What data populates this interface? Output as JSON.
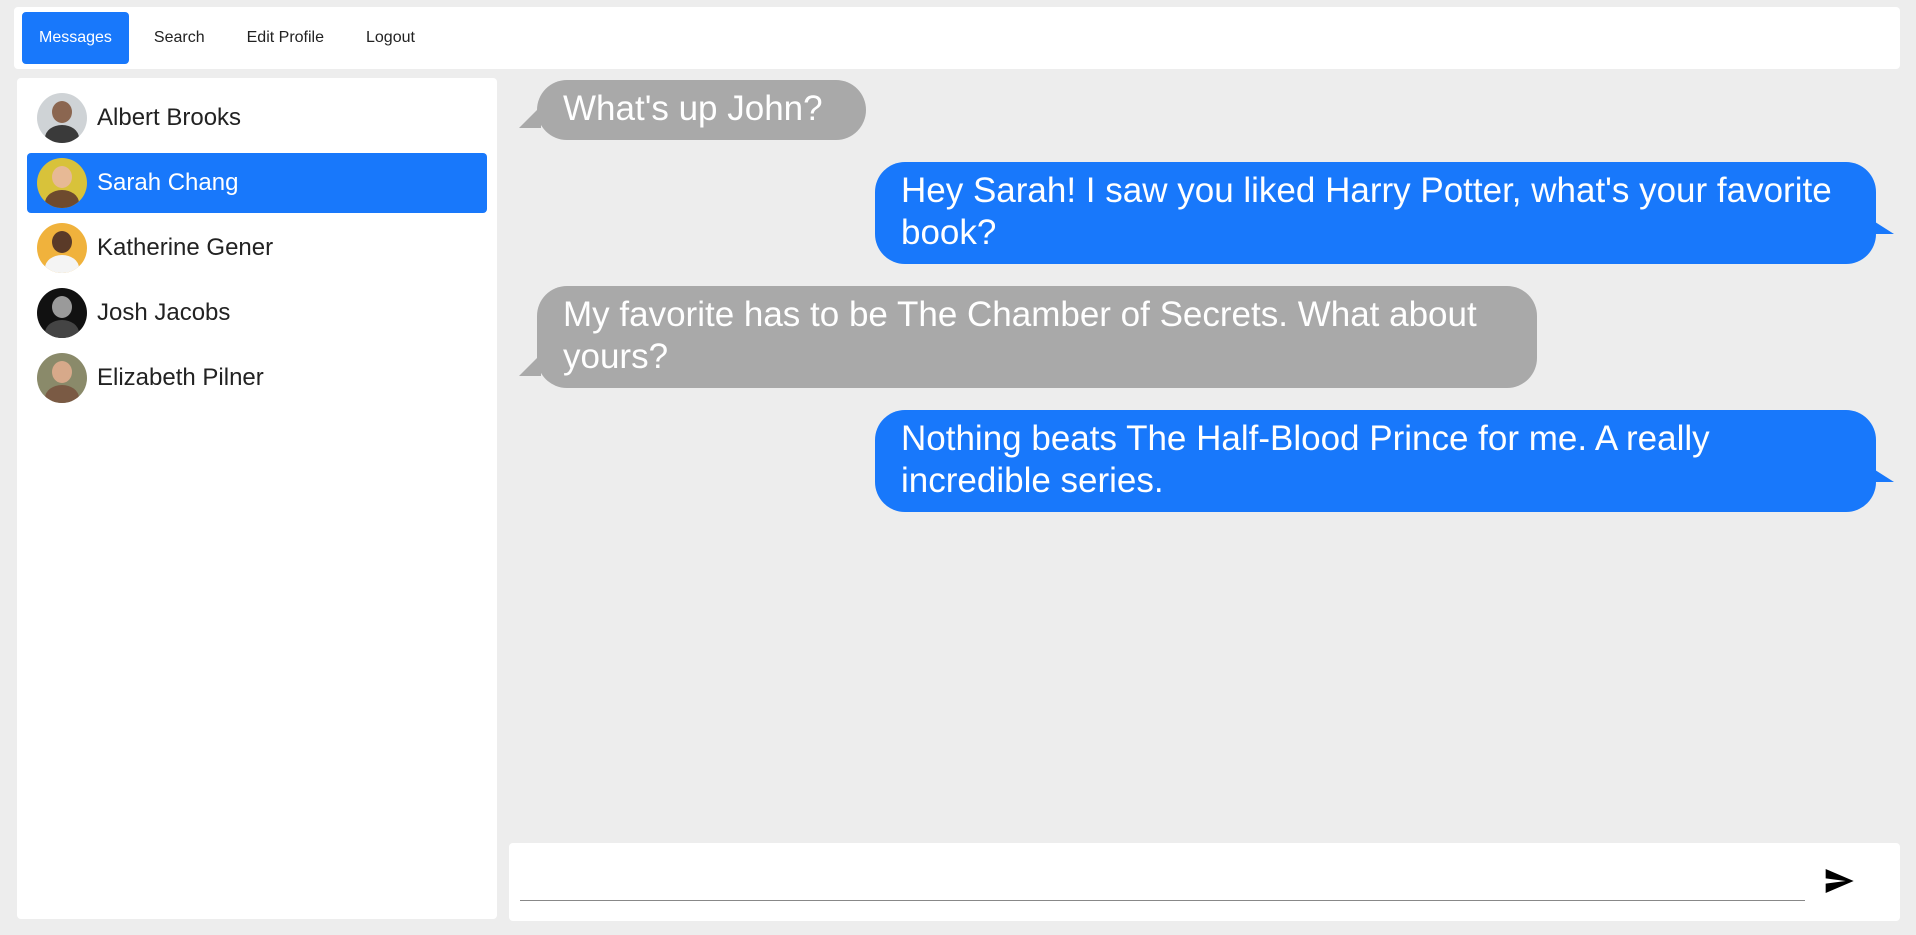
{
  "nav": {
    "items": [
      {
        "label": "Messages",
        "active": true
      },
      {
        "label": "Search"
      },
      {
        "label": "Edit Profile"
      },
      {
        "label": "Logout"
      }
    ]
  },
  "sidebar": {
    "contacts": [
      {
        "name": "Albert Brooks"
      },
      {
        "name": "Sarah Chang",
        "active": true
      },
      {
        "name": "Katherine Gener"
      },
      {
        "name": "Josh Jacobs"
      },
      {
        "name": "Elizabeth Pilner"
      }
    ]
  },
  "chat": {
    "messages": [
      {
        "from": "them",
        "text": "What's up John?"
      },
      {
        "from": "me",
        "text": "Hey Sarah! I saw you liked Harry Potter, what's your favorite book?"
      },
      {
        "from": "them",
        "text": "My favorite has to be The Chamber of Secrets. What about yours?"
      },
      {
        "from": "me",
        "text": "Nothing beats The Half-Blood Prince for me. A really incredible series."
      }
    ]
  },
  "composer": {
    "value": "",
    "placeholder": "",
    "send_icon": "send-icon"
  },
  "colors": {
    "accent": "#1878fb",
    "incoming_bubble": "#a9a9a9",
    "background": "#ededed"
  }
}
